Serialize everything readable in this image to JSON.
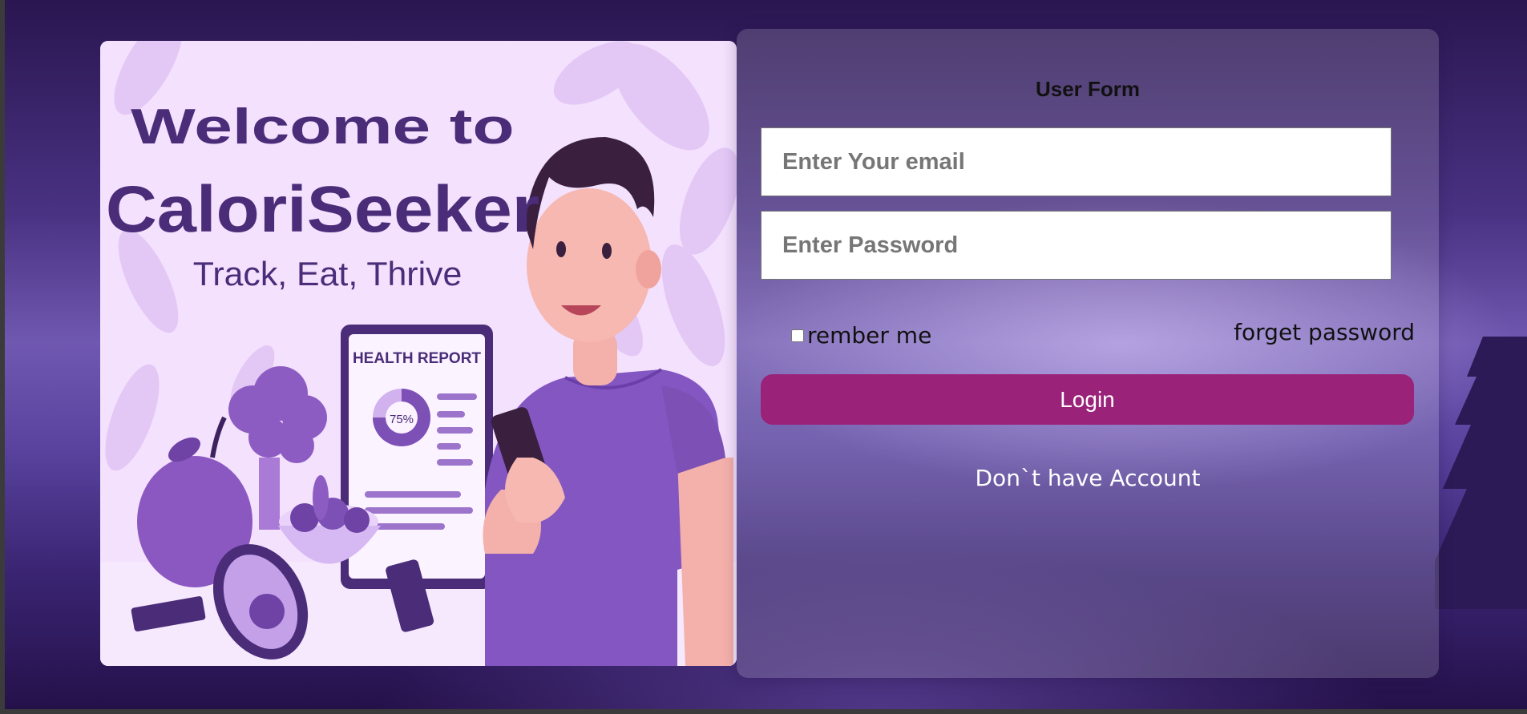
{
  "hero": {
    "welcome": "Welcome to",
    "brand": "CaloriSeeker",
    "tagline": "Track, Eat, Thrive",
    "report_title": "HEALTH REPORT",
    "report_percent": "75%",
    "report_progress": 0.75
  },
  "form": {
    "title": "User Form",
    "email_placeholder": "Enter Your email",
    "email_value": "",
    "password_placeholder": "Enter Password",
    "password_value": "",
    "remember_label": "rember me",
    "remember_checked": false,
    "forget_label": "forget password",
    "login_label": "Login",
    "signup_link": "Don`t have Account"
  },
  "colors": {
    "accent": "#9b2279",
    "brand_purple": "#4a2c79",
    "hero_background": "#f3e1fd"
  }
}
